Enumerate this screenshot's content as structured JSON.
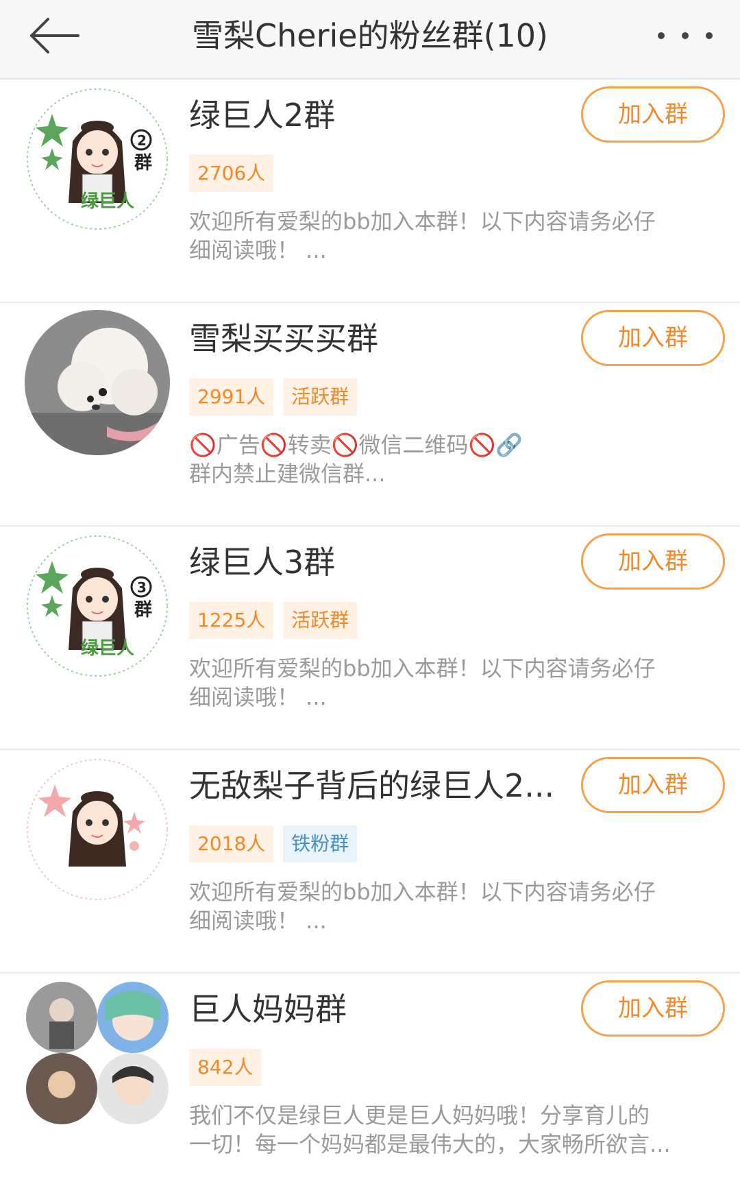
{
  "header": {
    "title": "雪梨Cherie的粉丝群(10)"
  },
  "groups": [
    {
      "name": "绿巨人2群",
      "join_label": "加入群",
      "tags": [
        "2706人"
      ],
      "desc_line1": "欢迎所有爱梨的bb加入本群！以下内容请务必仔",
      "desc_line2": "细阅读哦！ ...",
      "avatar_badge": "2群"
    },
    {
      "name": "雪梨买买买群",
      "join_label": "加入群",
      "tags": [
        "2991人",
        "活跃群"
      ],
      "desc_line1": "🚫广告🚫转卖🚫微信二维码🚫🔗",
      "desc_line2": "群内禁止建微信群..."
    },
    {
      "name": "绿巨人3群",
      "join_label": "加入群",
      "tags": [
        "1225人",
        "活跃群"
      ],
      "desc_line1": "欢迎所有爱梨的bb加入本群！以下内容请务必仔",
      "desc_line2": "细阅读哦！ ...",
      "avatar_badge": "3群"
    },
    {
      "name": "无敌梨子背后的绿巨人2...",
      "join_label": "加入群",
      "tags": [
        "2018人",
        "铁粉群"
      ],
      "desc_line1": "欢迎所有爱梨的bb加入本群！以下内容请务必仔",
      "desc_line2": "细阅读哦！ ..."
    },
    {
      "name": "巨人妈妈群",
      "join_label": "加入群",
      "tags": [
        "842人"
      ],
      "desc_line1": "我们不仅是绿巨人更是巨人妈妈哦！分享育儿的",
      "desc_line2": "一切！每一个妈妈都是最伟大的，大家畅所欲言..."
    }
  ],
  "colors": {
    "accent_orange": "#f08a2c",
    "tag_blue": "#4a90c6"
  }
}
